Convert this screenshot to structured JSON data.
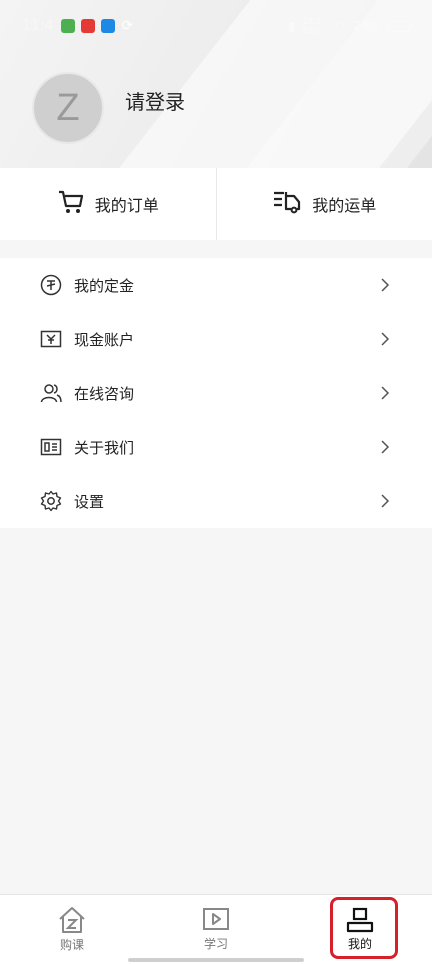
{
  "status_bar": {
    "time": "11:4",
    "network_speed": "24.3 KB/s",
    "battery": "24%"
  },
  "profile": {
    "avatar_initial": "Z",
    "login_text": "请登录"
  },
  "orders": {
    "my_orders": "我的订单",
    "my_shipments": "我的运单"
  },
  "menu": [
    {
      "label": "我的定金",
      "icon": "deposit-icon"
    },
    {
      "label": "现金账户",
      "icon": "cash-account-icon"
    },
    {
      "label": "在线咨询",
      "icon": "online-consult-icon"
    },
    {
      "label": "关于我们",
      "icon": "about-us-icon"
    },
    {
      "label": "设置",
      "icon": "settings-icon"
    }
  ],
  "bottom_nav": [
    {
      "label": "购课",
      "icon": "home-course-icon"
    },
    {
      "label": "学习",
      "icon": "play-icon"
    },
    {
      "label": "我的",
      "icon": "profile-icon",
      "active": true
    }
  ],
  "colors": {
    "highlight": "#d6202a",
    "text": "#222222",
    "muted": "#777777"
  }
}
